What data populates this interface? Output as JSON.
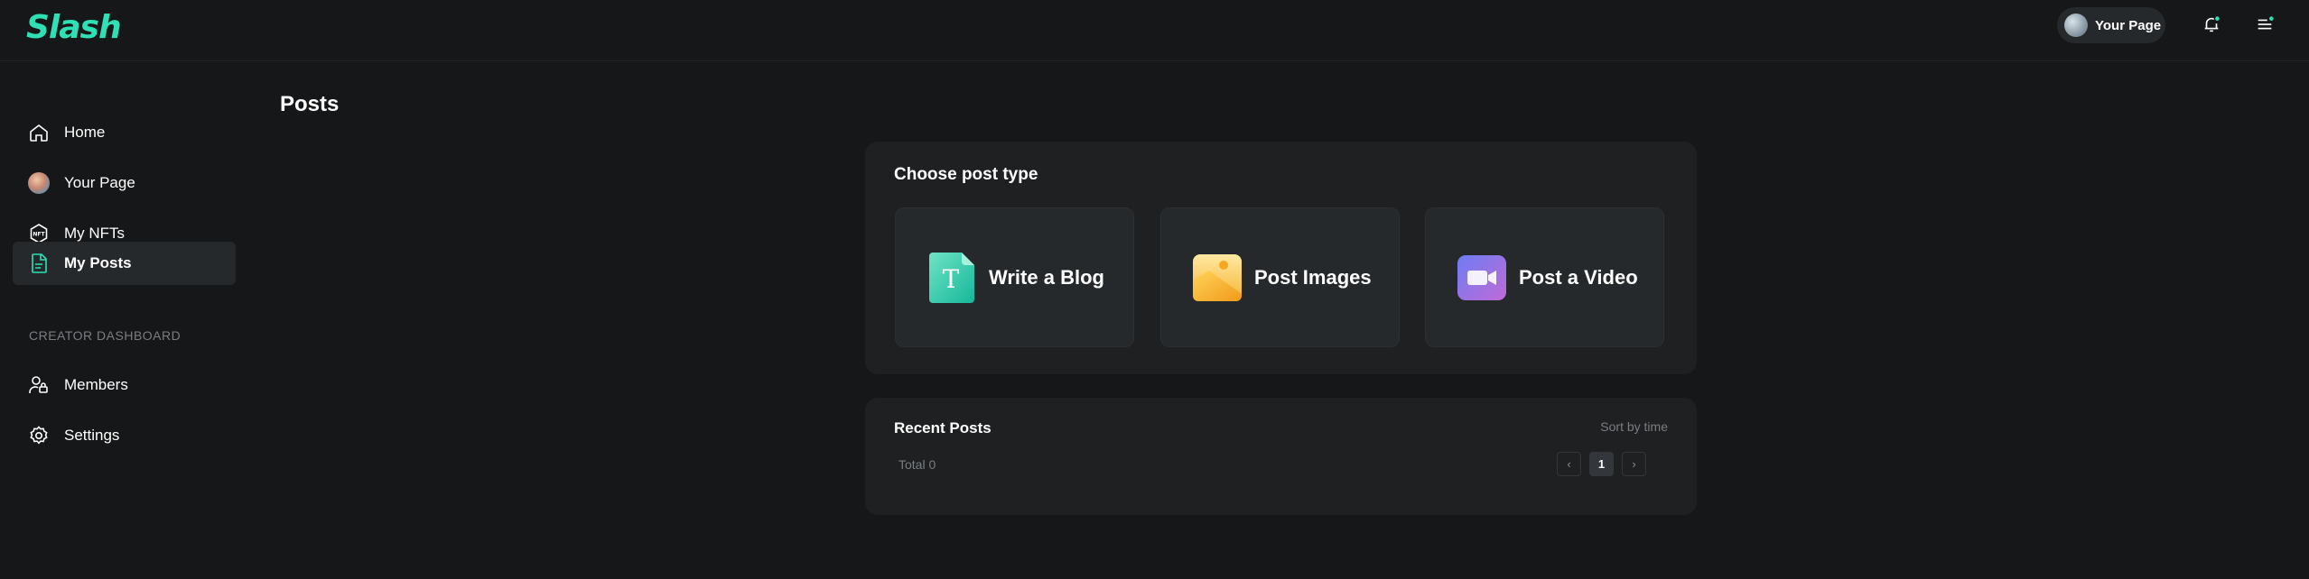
{
  "header": {
    "logo": "Slash",
    "your_page_label": "Your Page"
  },
  "sidebar": {
    "items": [
      {
        "label": "Home",
        "icon": "home-icon"
      },
      {
        "label": "Your Page",
        "icon": "avatar"
      },
      {
        "label": "My NFTs",
        "icon": "nft-icon"
      },
      {
        "label": "My Posts",
        "icon": "document-icon",
        "active": true
      }
    ],
    "section_label": "CREATOR DASHBOARD",
    "creator_items": [
      {
        "label": "Members",
        "icon": "members-icon"
      },
      {
        "label": "Settings",
        "icon": "gear-icon"
      }
    ]
  },
  "main": {
    "title": "Posts",
    "choose": {
      "title": "Choose post type",
      "types": [
        {
          "label": "Write a Blog",
          "icon": "blog-icon"
        },
        {
          "label": "Post Images",
          "icon": "image-icon"
        },
        {
          "label": "Post a Video",
          "icon": "video-icon"
        }
      ]
    },
    "recent": {
      "title": "Recent Posts",
      "sort_label": "Sort by time",
      "total_label": "Total 0",
      "current_page": "1",
      "prev": "‹",
      "next": "›"
    }
  },
  "colors": {
    "accent": "#2fe0b5",
    "background": "#161718",
    "card": "#1e2022",
    "tile": "#26292b"
  }
}
